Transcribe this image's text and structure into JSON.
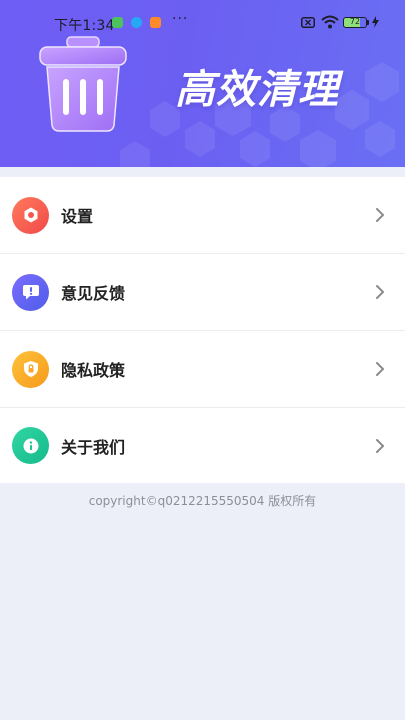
{
  "status_bar": {
    "time": "下午1:34",
    "more_dots": "···",
    "battery_level": "72"
  },
  "header": {
    "title": "高效清理",
    "icon": "trash-icon"
  },
  "menu": {
    "items": [
      {
        "label": "设置",
        "icon": "gear-icon",
        "color_from": "#ff7a5c",
        "color_to": "#f04a4a"
      },
      {
        "label": "意见反馈",
        "icon": "feedback-icon",
        "color_from": "#7b6cff",
        "color_to": "#4f5de8"
      },
      {
        "label": "隐私政策",
        "icon": "shield-icon",
        "color_from": "#ffc23a",
        "color_to": "#f59a1c"
      },
      {
        "label": "关于我们",
        "icon": "info-icon",
        "color_from": "#31d7a4",
        "color_to": "#16b98a"
      }
    ]
  },
  "footer": {
    "copyright": "copyright©q0212215550504 版权所有"
  },
  "colors": {
    "header_bg": "#6b5ff2",
    "page_bg": "#eceff8"
  }
}
